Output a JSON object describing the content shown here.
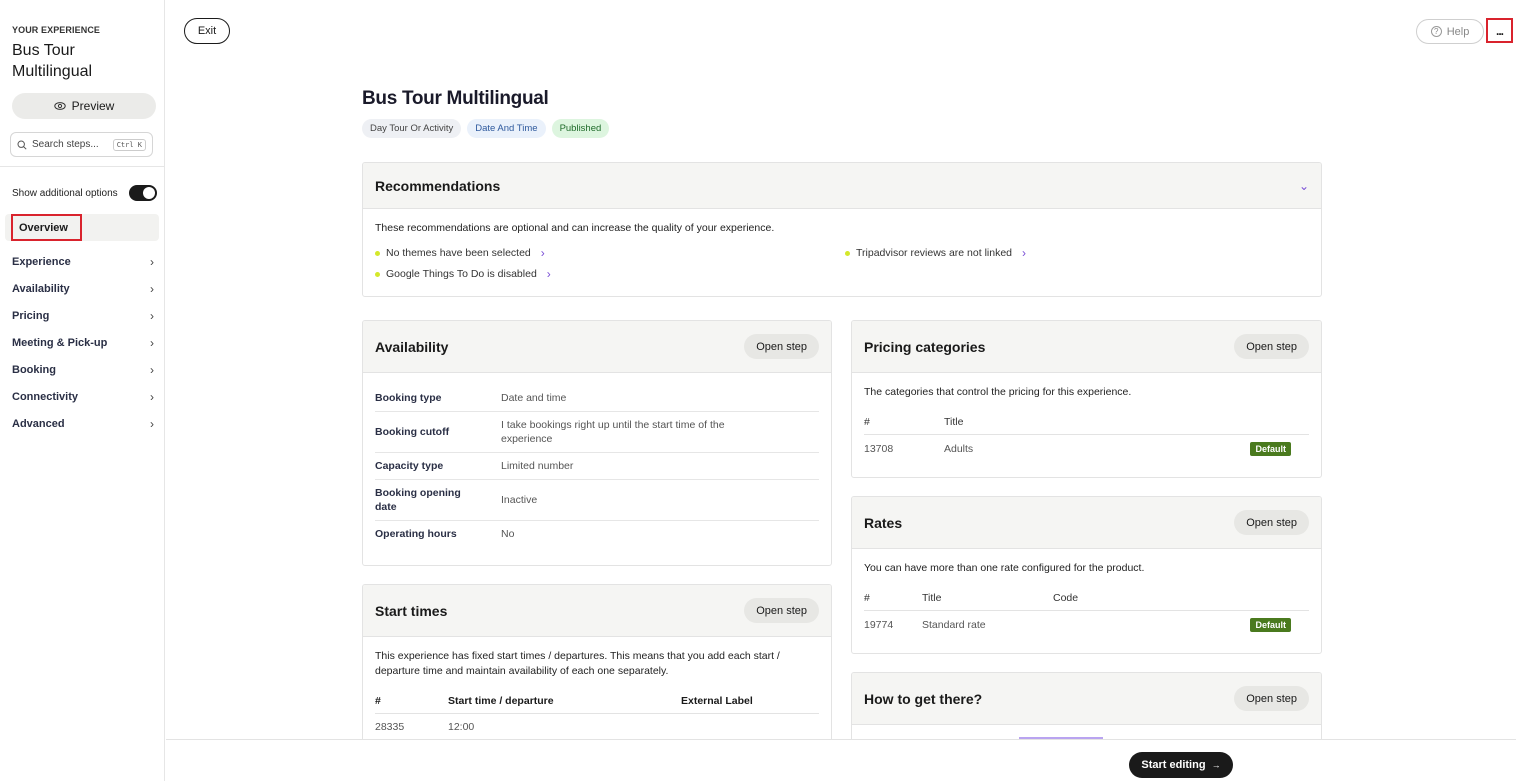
{
  "sidebar": {
    "eyebrow": "YOUR EXPERIENCE",
    "title": "Bus Tour Multilingual",
    "preview_label": "Preview",
    "search_placeholder": "Search steps...",
    "search_shortcut": "Ctrl K",
    "toggle_label": "Show additional options",
    "toggle_on": true,
    "active_item": "Overview",
    "items": [
      {
        "label": "Experience"
      },
      {
        "label": "Availability"
      },
      {
        "label": "Pricing"
      },
      {
        "label": "Meeting & Pick-up"
      },
      {
        "label": "Booking"
      },
      {
        "label": "Connectivity"
      },
      {
        "label": "Advanced"
      }
    ]
  },
  "topbar": {
    "exit_label": "Exit",
    "help_label": "Help",
    "more_label": "..."
  },
  "page": {
    "title": "Bus Tour Multilingual",
    "tags": [
      "Day Tour Or Activity",
      "Date And Time",
      "Published"
    ]
  },
  "recommendations": {
    "title": "Recommendations",
    "description": "These recommendations are optional and can increase the quality of your experience.",
    "items": [
      "No themes have been selected",
      "Tripadvisor reviews are not linked",
      "Google Things To Do is disabled"
    ]
  },
  "availability": {
    "title": "Availability",
    "open_step": "Open step",
    "rows": [
      {
        "k": "Booking type",
        "v": "Date and time"
      },
      {
        "k": "Booking cutoff",
        "v": "I take bookings right up until the start time of the experience"
      },
      {
        "k": "Capacity type",
        "v": "Limited number"
      },
      {
        "k": "Booking opening date",
        "v": "Inactive"
      },
      {
        "k": "Operating hours",
        "v": "No"
      }
    ]
  },
  "start_times": {
    "title": "Start times",
    "open_step": "Open step",
    "description": "This experience has fixed start times / departures. This means that you add each start / departure time and maintain availability of each one separately.",
    "headers": [
      "#",
      "Start time / departure",
      "External Label"
    ],
    "rows": [
      [
        "28335",
        "12:00",
        ""
      ]
    ]
  },
  "pricing_categories": {
    "title": "Pricing categories",
    "open_step": "Open step",
    "description": "The categories that control the pricing for this experience.",
    "headers": [
      "#",
      "Title"
    ],
    "rows": [
      {
        "id": "13708",
        "title": "Adults",
        "badge": "Default"
      }
    ]
  },
  "rates": {
    "title": "Rates",
    "open_step": "Open step",
    "description": "You can have more than one rate configured for the product.",
    "headers": [
      "#",
      "Title",
      "Code"
    ],
    "rows": [
      {
        "id": "19774",
        "title": "Standard rate",
        "code": "",
        "badge": "Default"
      }
    ]
  },
  "how_to_get_there": {
    "title": "How to get there?",
    "open_step": "Open step"
  },
  "footer": {
    "start_editing_label": "Start editing",
    "arrow": "→"
  },
  "colors": {
    "accent_purple": "#7a4fd6",
    "recommendation_dot": "#d4e82a",
    "default_badge": "#4a7a1e",
    "highlight_red": "#d9232d"
  }
}
